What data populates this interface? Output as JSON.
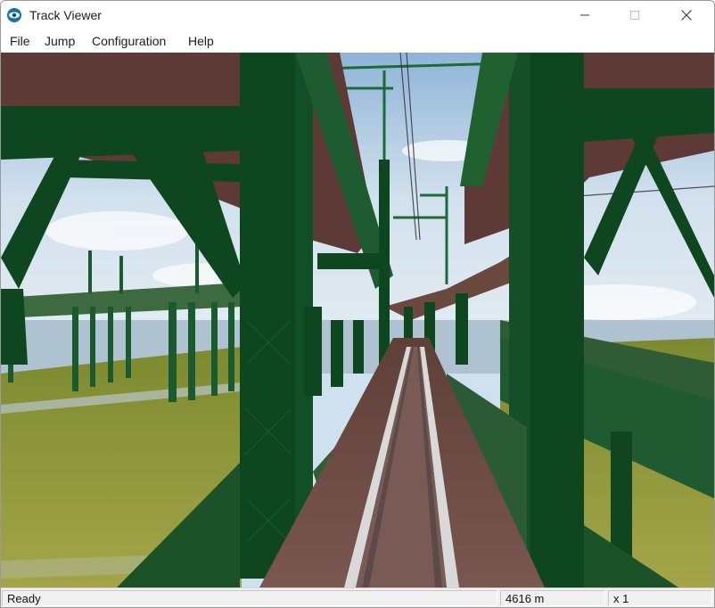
{
  "window": {
    "title": "Track Viewer",
    "icon": "app-logo-icon",
    "controls": [
      "minimize-icon",
      "maximize-icon",
      "close-icon"
    ]
  },
  "menu": {
    "items": [
      {
        "label": "File"
      },
      {
        "label": "Jump"
      },
      {
        "label": "Configuration"
      },
      {
        "label": "Help"
      }
    ]
  },
  "viewport": {
    "scene": "3d-track-view"
  },
  "status": {
    "state": "Ready",
    "distance": "4616 m",
    "zoom": "x 1"
  },
  "colors": {
    "girder_green": "#0f3f1f",
    "rail_deck": "#6b4a42",
    "grass": "#8f9a3a",
    "sky": "#c3d7ea"
  }
}
